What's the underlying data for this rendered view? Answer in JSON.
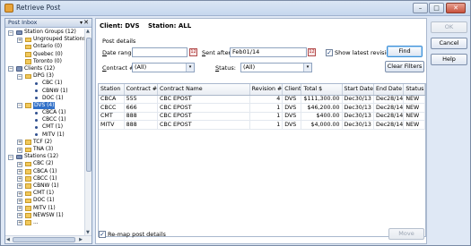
{
  "window": {
    "title": "Retrieve Post",
    "controls": {
      "minimize": "–",
      "maximize": "□",
      "close": "✕"
    }
  },
  "left_pane": {
    "title": "Post Inbox",
    "pin": "▾",
    "close": "✕",
    "tree": [
      {
        "label": "Station Groups (12)",
        "icon": "group-icon",
        "level": 0,
        "expanded": true
      },
      {
        "label": "Ungrouped Stations",
        "icon": "folder-icon",
        "level": 1,
        "expanded": false
      },
      {
        "label": "Ontario (0)",
        "icon": "folder-icon",
        "level": 1
      },
      {
        "label": "Quebec (0)",
        "icon": "folder-icon",
        "level": 1
      },
      {
        "label": "Toronto (0)",
        "icon": "folder-icon",
        "level": 1
      },
      {
        "label": "Clients (12)",
        "icon": "group-icon",
        "level": 0,
        "expanded": true
      },
      {
        "label": "DPG (3)",
        "icon": "folder-icon",
        "level": 1,
        "expanded": true
      },
      {
        "label": "CBC (1)",
        "icon": "dot-icon",
        "level": 2
      },
      {
        "label": "CBNW (1)",
        "icon": "dot-icon",
        "level": 2
      },
      {
        "label": "DOC (1)",
        "icon": "dot-icon",
        "level": 2
      },
      {
        "label": "DVS (4)",
        "icon": "folder-icon",
        "level": 1,
        "expanded": true,
        "selected": true
      },
      {
        "label": "CBCA (1)",
        "icon": "dot-icon",
        "level": 2
      },
      {
        "label": "CBCC (1)",
        "icon": "dot-icon",
        "level": 2
      },
      {
        "label": "CMT (1)",
        "icon": "dot-icon",
        "level": 2
      },
      {
        "label": "MITV (1)",
        "icon": "dot-icon",
        "level": 2
      },
      {
        "label": "TCF (2)",
        "icon": "folder-icon",
        "level": 1,
        "expanded": false
      },
      {
        "label": "TNA (3)",
        "icon": "folder-icon",
        "level": 1,
        "expanded": false
      },
      {
        "label": "Stations (12)",
        "icon": "group-icon",
        "level": 0,
        "expanded": true
      },
      {
        "label": "CBC (2)",
        "icon": "folder-icon",
        "level": 1,
        "expanded": false
      },
      {
        "label": "CBCA (1)",
        "icon": "folder-icon",
        "level": 1,
        "expanded": false
      },
      {
        "label": "CBCC (1)",
        "icon": "folder-icon",
        "level": 1,
        "expanded": false
      },
      {
        "label": "CBNW (1)",
        "icon": "folder-icon",
        "level": 1,
        "expanded": false
      },
      {
        "label": "CMT (1)",
        "icon": "folder-icon",
        "level": 1,
        "expanded": false
      },
      {
        "label": "DOC (1)",
        "icon": "folder-icon",
        "level": 1,
        "expanded": false
      },
      {
        "label": "MITV (1)",
        "icon": "folder-icon",
        "level": 1,
        "expanded": false
      },
      {
        "label": "NEWSW (1)",
        "icon": "folder-icon",
        "level": 1,
        "expanded": false
      },
      {
        "label": "...",
        "icon": "folder-icon",
        "level": 1,
        "expanded": false
      }
    ]
  },
  "main": {
    "client_label": "Client: DVS",
    "station_label": "Station: ALL",
    "post_details_label": "Post details",
    "date_range": {
      "label_pre": "",
      "label_ul": "D",
      "label_post": "ate range:",
      "value": ""
    },
    "sent_after": {
      "label_ul": "S",
      "label_post": "ent after:",
      "value": "Feb01/14"
    },
    "show_latest": {
      "label": "Show latest revision",
      "checked": "✓"
    },
    "contract": {
      "label_pre": "",
      "label_ul": "C",
      "label_post": "ontract #:",
      "value": "(All)"
    },
    "status": {
      "label_ul": "S",
      "label_post": "tatus:",
      "value": "(All)"
    },
    "find_button": "Find",
    "clear_filters_button": "Clear Filters",
    "calendar_glyph": "12",
    "dropdown_glyph": "▾",
    "columns": [
      "Station",
      "Contract #",
      "Contract Name",
      "Revision #",
      "Client",
      "Total $",
      "Start Date",
      "End Date",
      "Status"
    ],
    "rows": [
      [
        "CBCA",
        "555",
        "CBC EPOST",
        "4",
        "DVS",
        "$111,300.00",
        "Dec30/13",
        "Dec28/14",
        "NEW"
      ],
      [
        "CBCC",
        "666",
        "CBC EPOST",
        "1",
        "DVS",
        "$46,200.00",
        "Dec30/13",
        "Dec28/14",
        "NEW"
      ],
      [
        "CMT",
        "888",
        "CBC EPOST",
        "1",
        "DVS",
        "$400.00",
        "Dec30/13",
        "Dec28/14",
        "NEW"
      ],
      [
        "MITV",
        "888",
        "CBC EPOST",
        "1",
        "DVS",
        "$4,000.00",
        "Dec30/13",
        "Dec28/14",
        "NEW"
      ]
    ],
    "remap": {
      "label": "Re-map post details",
      "checked": "✓"
    },
    "move_button": "Move"
  },
  "right_buttons": {
    "ok": "OK",
    "cancel": "Cancel",
    "help": "Help"
  }
}
